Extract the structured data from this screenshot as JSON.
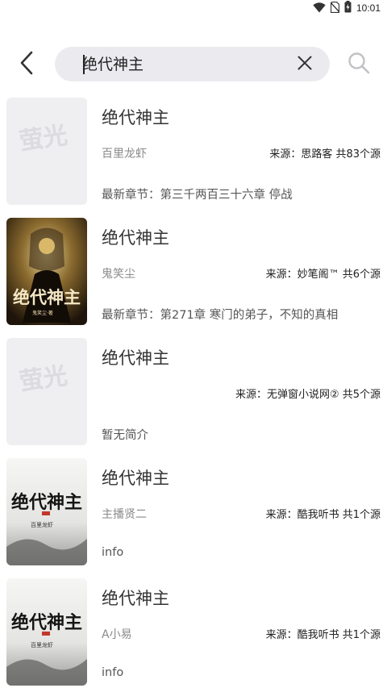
{
  "status_bar": {
    "time": "10:01",
    "icons": [
      "wifi-icon",
      "no-sim-icon",
      "battery-icon"
    ]
  },
  "search": {
    "query": "绝代神主",
    "back_icon": "chevron-left-icon",
    "clear_icon": "close-icon",
    "search_icon": "search-icon"
  },
  "placeholder_cover_text": "萤光",
  "results": [
    {
      "title": "绝代神主",
      "author": "百里龙虾",
      "source": "来源：思路客 共83个源",
      "latest": "最新章节：第三千两百三十六章 停战",
      "cover": "placeholder"
    },
    {
      "title": "绝代神主",
      "author": "鬼笑尘",
      "source": "来源：妙笔阁™ 共6个源",
      "latest": "最新章节：第271章 寒门的弟子，不知的真相",
      "cover": "dark",
      "cover_text": "绝代神主",
      "cover_sub": "鬼笑尘·著"
    },
    {
      "title": "绝代神主",
      "author": "",
      "source": "来源：无弹窗小说网② 共5个源",
      "latest": "暂无简介",
      "cover": "placeholder"
    },
    {
      "title": "绝代神主",
      "author": "主播贤二",
      "source": "来源：酷我听书 共1个源",
      "latest": "info",
      "cover": "ink",
      "cover_text": "绝代神主",
      "cover_sub": "百里龙虾"
    },
    {
      "title": "绝代神主",
      "author": "A小易",
      "source": "来源：酷我听书 共1个源",
      "latest": "info",
      "cover": "ink",
      "cover_text": "绝代神主",
      "cover_sub": "百里龙虾"
    }
  ]
}
